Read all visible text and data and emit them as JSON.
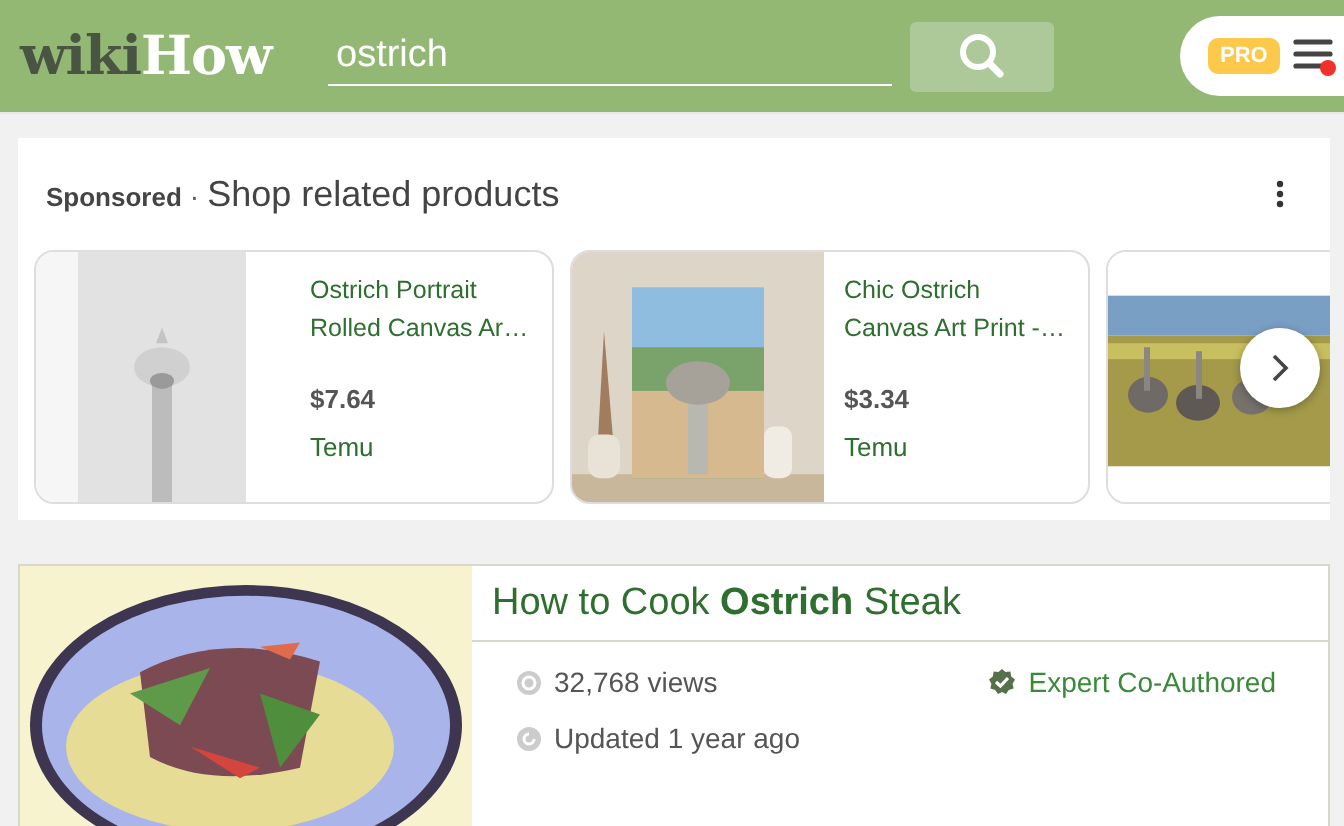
{
  "header": {
    "logo": {
      "dark": "wiki",
      "light": "How"
    },
    "search": {
      "value": "ostrich"
    },
    "pro_badge": "PRO",
    "menu": {
      "notification": true
    }
  },
  "sponsored": {
    "label": "Sponsored",
    "separator": "·",
    "title": "Shop related products",
    "products": [
      {
        "kind": "product",
        "name_lines": [
          "Ostrich Portrait",
          "Rolled Canvas Ar…"
        ],
        "price": "$7.64",
        "seller": "Temu"
      },
      {
        "kind": "product",
        "name_lines": [
          "Chic Ostrich",
          "Canvas Art Print -…"
        ],
        "price": "$3.34",
        "seller": "Temu"
      },
      {
        "kind": "picture"
      }
    ]
  },
  "article": {
    "title": "How to Cook **Ostrich** Steak",
    "views": "32,768 views",
    "updated": "Updated 1 year ago",
    "badge": "Expert Co-Authored"
  }
}
